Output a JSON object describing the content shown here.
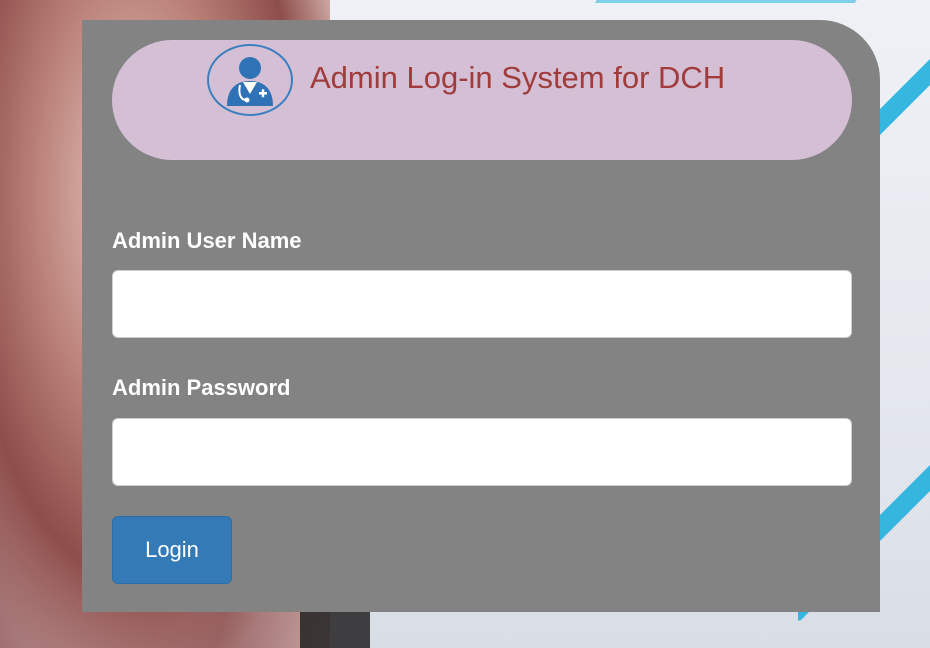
{
  "header": {
    "title": "Admin Log-in System for DCH",
    "logo_icon": "doctor-avatar-icon"
  },
  "form": {
    "username_label": "Admin User Name",
    "username_value": "",
    "password_label": "Admin Password",
    "password_value": "",
    "login_label": "Login"
  },
  "colors": {
    "panel_bg": "#838383",
    "header_pill_bg": "#d4bfd4",
    "title_color": "#a03c3c",
    "button_bg": "#337ab7",
    "logo_blue": "#3b7fc0"
  }
}
